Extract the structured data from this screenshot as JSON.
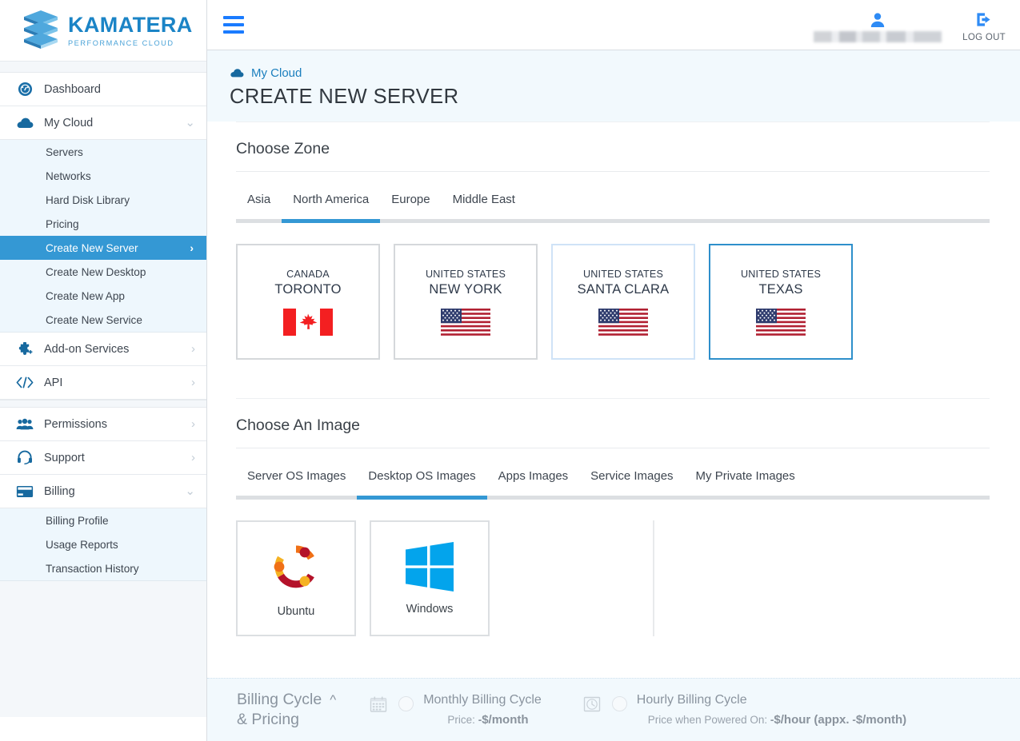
{
  "brand": {
    "name": "KAMATERA",
    "tagline": "PERFORMANCE CLOUD",
    "logo_color": "#1b84c6",
    "accent": "#3498d4"
  },
  "topbar": {
    "menu_icon": "hamburger-icon",
    "user_icon": "user-avatar-icon",
    "user_name_redacted": "",
    "logout_icon": "logout-icon",
    "logout_label": "LOG OUT"
  },
  "page": {
    "breadcrumb_icon": "cloud-icon",
    "breadcrumb": "My Cloud",
    "title": "CREATE NEW SERVER"
  },
  "sidebar": {
    "items": [
      {
        "label": "Dashboard",
        "icon": "dashboard-gauge-icon",
        "chevron": ""
      },
      {
        "label": "My Cloud",
        "icon": "cloud-icon",
        "chevron": "⌄"
      }
    ],
    "my_cloud_sub": [
      {
        "label": "Servers",
        "active": false
      },
      {
        "label": "Networks",
        "active": false
      },
      {
        "label": "Hard Disk Library",
        "active": false
      },
      {
        "label": "Pricing",
        "active": false
      },
      {
        "label": "Create New Server",
        "active": true,
        "chevron": "›"
      },
      {
        "label": "Create New Desktop",
        "active": false
      },
      {
        "label": "Create New App",
        "active": false
      },
      {
        "label": "Create New Service",
        "active": false
      }
    ],
    "items2": [
      {
        "label": "Add-on Services",
        "icon": "puzzle-piece-icon",
        "chevron": "›"
      },
      {
        "label": "API",
        "icon": "code-brackets-icon",
        "chevron": "›"
      }
    ],
    "items3": [
      {
        "label": "Permissions",
        "icon": "users-group-icon",
        "chevron": "›"
      },
      {
        "label": "Support",
        "icon": "headset-icon",
        "chevron": "›"
      },
      {
        "label": "Billing",
        "icon": "credit-card-icon",
        "chevron": "⌄"
      }
    ],
    "billing_sub": [
      {
        "label": "Billing Profile"
      },
      {
        "label": "Usage Reports"
      },
      {
        "label": "Transaction History"
      }
    ]
  },
  "zone": {
    "heading": "Choose Zone",
    "tabs": [
      {
        "label": "Asia",
        "active": false
      },
      {
        "label": "North America",
        "active": true
      },
      {
        "label": "Europe",
        "active": false
      },
      {
        "label": "Middle East",
        "active": false
      }
    ],
    "cards": [
      {
        "country": "CANADA",
        "city": "TORONTO",
        "flag": "canada-flag-icon",
        "state": "default"
      },
      {
        "country": "UNITED STATES",
        "city": "NEW YORK",
        "flag": "usa-flag-icon",
        "state": "default"
      },
      {
        "country": "UNITED STATES",
        "city": "SANTA CLARA",
        "flag": "usa-flag-icon",
        "state": "hover"
      },
      {
        "country": "UNITED STATES",
        "city": "TEXAS",
        "flag": "usa-flag-icon",
        "state": "selected"
      }
    ]
  },
  "image": {
    "heading": "Choose An Image",
    "tabs": [
      {
        "label": "Server OS Images",
        "active": false
      },
      {
        "label": "Desktop OS Images",
        "active": true
      },
      {
        "label": "Apps Images",
        "active": false
      },
      {
        "label": "Service Images",
        "active": false
      },
      {
        "label": "My Private Images",
        "active": false
      }
    ],
    "cards": [
      {
        "label": "Ubuntu",
        "icon": "ubuntu-logo-icon"
      },
      {
        "label": "Windows",
        "icon": "windows-logo-icon"
      }
    ]
  },
  "billing": {
    "title_line1": "Billing Cycle",
    "title_line2": "& Pricing",
    "collapse_icon": "chevron-up-icon",
    "monthly": {
      "icon": "calendar-icon",
      "label": "Monthly Billing Cycle",
      "price_prefix": "Price:",
      "price_dash": "-",
      "price_unit": "$/month",
      "selected": false
    },
    "hourly": {
      "icon": "clock-icon",
      "label": "Hourly Billing Cycle",
      "price_prefix": "Price when Powered On:",
      "price_dash": "-",
      "price_unit": "$/hour (appx.",
      "price_dash2": "-",
      "price_unit2": "$/month)",
      "selected": false
    }
  }
}
